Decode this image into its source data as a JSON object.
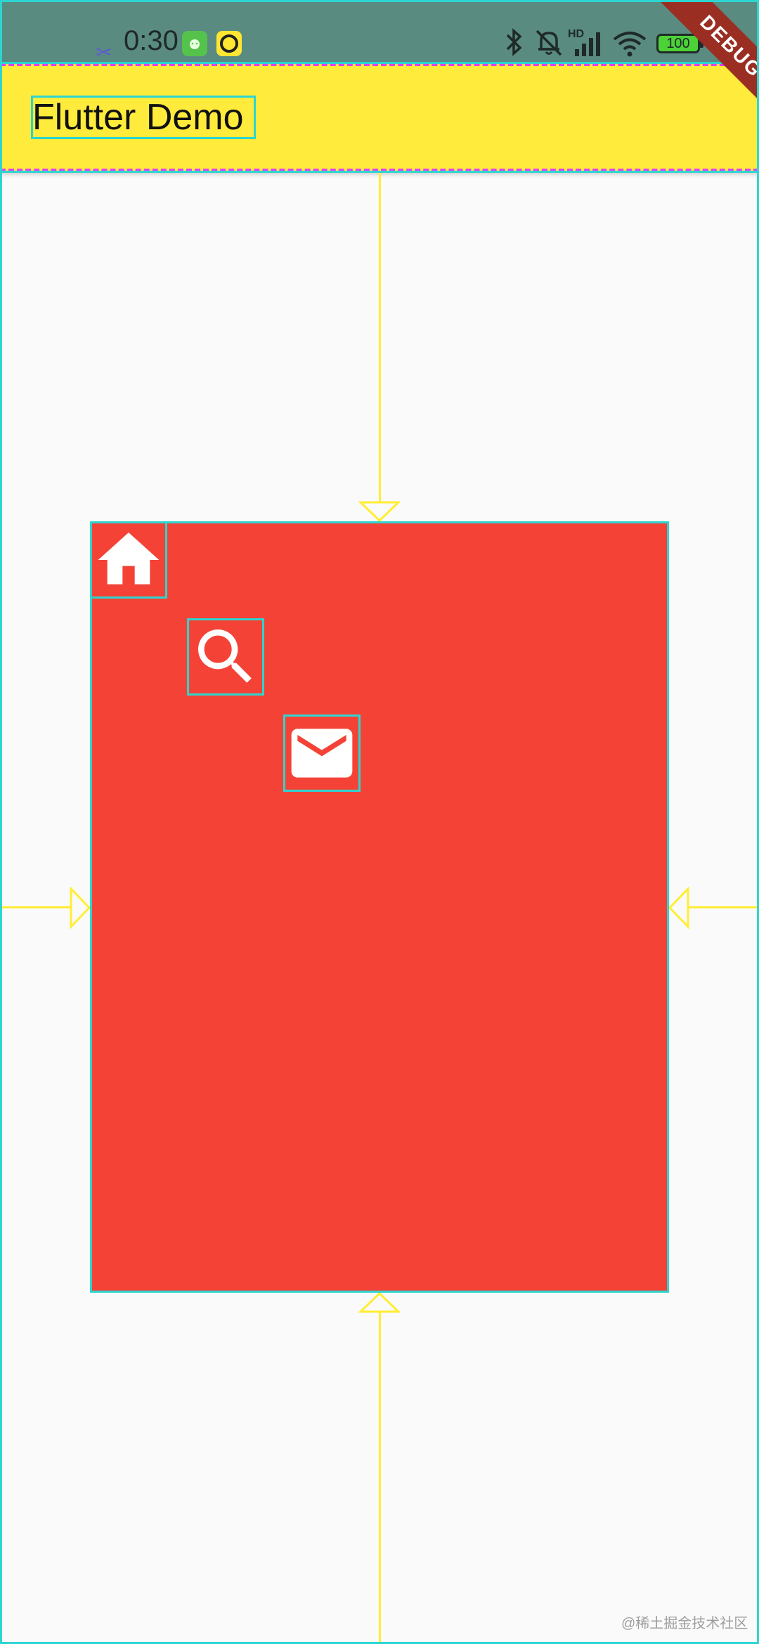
{
  "status_bar": {
    "time": "0:30",
    "hd_label": "HD",
    "battery_level": "100",
    "icons": [
      "scissor-icon",
      "android-icon",
      "ring-icon",
      "bluetooth-icon",
      "mute-bell-icon",
      "signal-icon",
      "wifi-icon",
      "battery-icon"
    ]
  },
  "debug_banner": "DEBUG",
  "app_bar": {
    "title": "Flutter Demo",
    "background": "#ffeb3b"
  },
  "content": {
    "container_color": "#f44336",
    "icons": [
      "home-icon",
      "search-icon",
      "mail-icon"
    ]
  },
  "watermark": "@稀土掘金技术社区"
}
